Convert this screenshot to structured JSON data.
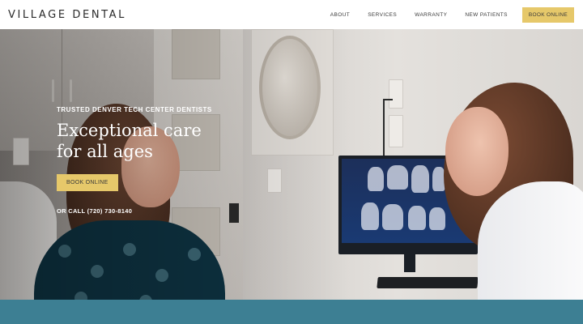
{
  "header": {
    "logo": "VILLAGE DENTAL",
    "nav": [
      "ABOUT",
      "SERVICES",
      "WARRANTY",
      "NEW PATIENTS"
    ],
    "cta": "BOOK ONLINE"
  },
  "hero": {
    "eyebrow": "TRUSTED DENVER TECH CENTER DENTISTS",
    "headline_line1": "Exceptional care",
    "headline_line2": "for all ages",
    "cta": "BOOK ONLINE",
    "call": "OR CALL (720) 730-8140"
  },
  "colors": {
    "accent": "#e6c86a",
    "band": "#3d7f93",
    "header_bg": "#ffffff"
  }
}
